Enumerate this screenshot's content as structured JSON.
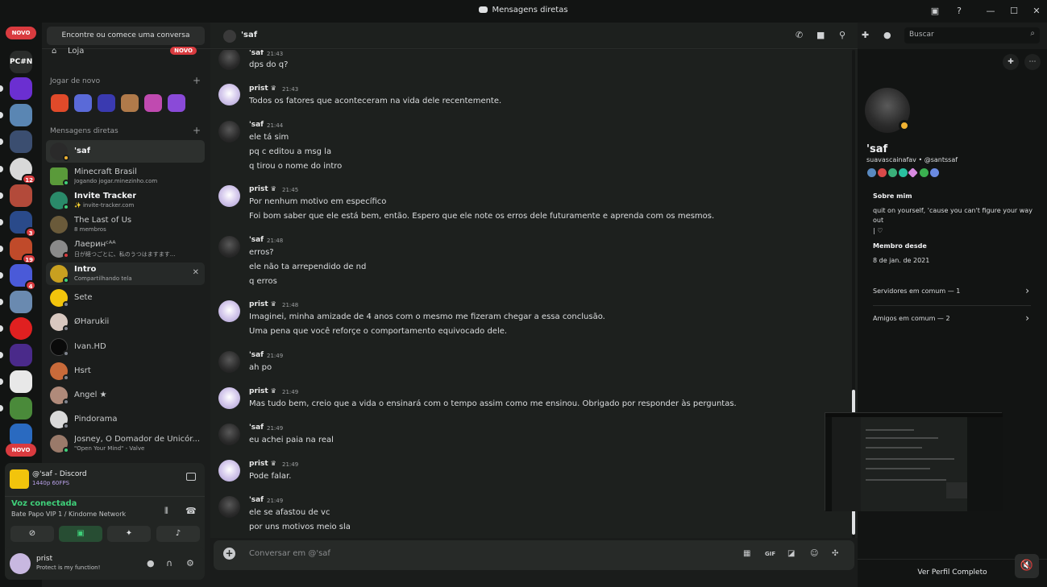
{
  "window": {
    "title": "Mensagens diretas"
  },
  "rail": {
    "top_badge": "NOVO",
    "bottom_badge": "NOVO",
    "pcn_label": "PC#N",
    "badges": [
      "12",
      "3",
      "19",
      "4"
    ]
  },
  "sidebar": {
    "search_placeholder": "Encontre ou comece uma conversa",
    "shop_label": "Loja",
    "shop_badge": "NOVO",
    "play_again_header": "Jogar de novo",
    "dm_header": "Mensagens diretas",
    "dms": [
      {
        "name": "'saf",
        "sub": ""
      },
      {
        "name": "Minecraft Brasil",
        "sub": "Jogando jogar.minezinho.com"
      },
      {
        "name": "Invite Tracker",
        "sub": "✨ invite-tracker.com"
      },
      {
        "name": "The Last of Us",
        "sub": "8 membros"
      },
      {
        "name": "Лаеринᶜᴬᴬ",
        "sub": "日が経つごとに、私のうつはますます..."
      },
      {
        "name": "Intro",
        "sub": "Compartilhando tela"
      },
      {
        "name": "Sete",
        "sub": ""
      },
      {
        "name": "ØHarukii",
        "sub": ""
      },
      {
        "name": "Ivan.HD",
        "sub": ""
      },
      {
        "name": "Hsrt",
        "sub": ""
      },
      {
        "name": "Angel ★",
        "sub": ""
      },
      {
        "name": "Pindorama",
        "sub": ""
      },
      {
        "name": "Josney, O Domador de Unicór...",
        "sub": "\"Open Your Mind\" - Valve"
      }
    ]
  },
  "stream_panel": {
    "title": "@'saf - Discord",
    "resolution": "1440p 60FPS",
    "voice_label": "Voz conectada",
    "voice_channel": "Bate Papo VIP 1 / Kindome Network"
  },
  "user_panel": {
    "name": "prist",
    "status": "Protect is my function!"
  },
  "chat": {
    "channel_name": "'saf",
    "search_placeholder": "Buscar",
    "composer_placeholder": "Conversar em @'saf",
    "messages": [
      {
        "author": "'saf",
        "time": "21:43",
        "lines": [
          "dps do q?"
        ]
      },
      {
        "author": "prist",
        "time": "21:43",
        "lines": [
          "Todos os fatores que aconteceram na vida dele recentemente."
        ]
      },
      {
        "author": "'saf",
        "time": "21:44",
        "lines": [
          "ele tá sim",
          "pq c editou a msg la",
          "q tirou o nome do intro"
        ]
      },
      {
        "author": "prist",
        "time": "21:45",
        "lines": [
          "Por nenhum motivo em específico",
          "Foi bom saber que ele está bem, então. Espero que ele note os erros dele futuramente e aprenda com os mesmos."
        ]
      },
      {
        "author": "'saf",
        "time": "21:48",
        "lines": [
          "erros?",
          "ele não ta arrependido de nd",
          "q erros"
        ]
      },
      {
        "author": "prist",
        "time": "21:48",
        "lines": [
          "Imaginei, minha amizade de 4 anos com o mesmo me fizeram chegar a essa conclusão.",
          "Uma pena que você reforçe o comportamento equivocado dele."
        ]
      },
      {
        "author": "'saf",
        "time": "21:49",
        "lines": [
          "ah po"
        ]
      },
      {
        "author": "prist",
        "time": "21:49",
        "lines": [
          "Mas tudo bem, creio que a vida o ensinará com o tempo assim como me ensinou. Obrigado por responder às perguntas."
        ]
      },
      {
        "author": "'saf",
        "time": "21:49",
        "lines": [
          "eu achei paia na real"
        ]
      },
      {
        "author": "prist",
        "time": "21:49",
        "lines": [
          "Pode falar."
        ]
      },
      {
        "author": "'saf",
        "time": "21:49",
        "lines": [
          "ele se afastou de vc",
          "por uns motivos meio sla"
        ]
      }
    ]
  },
  "profile": {
    "display_name": "'saf",
    "username_line": "suavascainafav • @santssaf",
    "about_header": "Sobre mim",
    "about_text": "quit on yourself, 'cause you can't figure your way out",
    "about_extra": "| ♡",
    "member_since_header": "Membro desde",
    "member_since": "8 de jan. de 2021",
    "mutual_servers": "Servidores em comum — 1",
    "mutual_friends": "Amigos em comum — 2",
    "full_profile": "Ver Perfil Completo"
  },
  "colors": {
    "accent_red": "#d93b3f",
    "voice_green": "#3fd07a",
    "idle_yellow": "#f0b232"
  }
}
